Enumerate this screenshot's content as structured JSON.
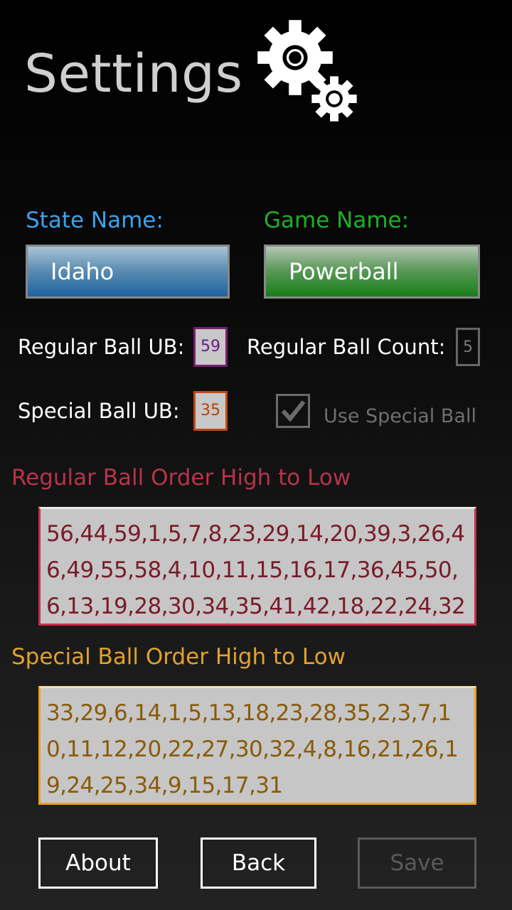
{
  "header": {
    "title": "Settings",
    "icon": "gears-icon"
  },
  "state": {
    "label": "State Name:",
    "value": "Idaho"
  },
  "game": {
    "label": "Game Name:",
    "value": "Powerball"
  },
  "regular_ball": {
    "ub_label": "Regular Ball UB:",
    "ub_value": "59",
    "count_label": "Regular Ball Count:",
    "count_value": "5"
  },
  "special_ball": {
    "ub_label": "Special Ball UB:",
    "ub_value": "35",
    "use_label": "Use Special Ball",
    "use_checked": true
  },
  "regular_order": {
    "title": "Regular Ball Order High to Low",
    "value": "56,44,59,1,5,7,8,23,29,14,20,39,3,26,46,49,55,58,4,10,11,15,16,17,36,45,50,6,13,19,28,30,34,35,41,42,18,22,24,32"
  },
  "special_order": {
    "title": "Special Ball Order High to Low",
    "value": "33,29,6,14,1,5,13,18,23,28,35,2,3,7,10,11,12,20,22,27,30,32,4,8,16,21,26,19,24,25,34,9,15,17,31"
  },
  "buttons": {
    "about": "About",
    "back": "Back",
    "save": "Save"
  },
  "colors": {
    "state_accent": "#3aa3ee",
    "game_accent": "#1fae2a",
    "regular_accent": "#c73049",
    "special_accent": "#f0a01e"
  }
}
